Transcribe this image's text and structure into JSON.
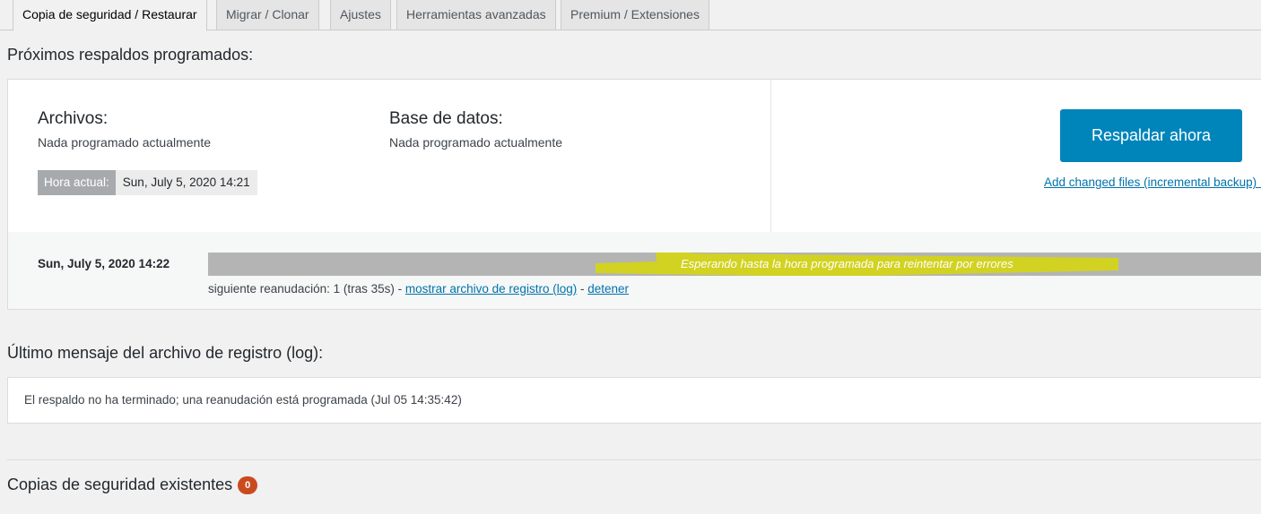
{
  "tabs": [
    {
      "label": "Copia de seguridad / Restaurar",
      "active": true
    },
    {
      "label": "Migrar / Clonar",
      "active": false
    },
    {
      "label": "Ajustes",
      "active": false
    },
    {
      "label": "Herramientas avanzadas",
      "active": false
    },
    {
      "label": "Premium / Extensiones",
      "active": false
    }
  ],
  "scheduled": {
    "heading": "Próximos respaldos programados:",
    "files_title": "Archivos:",
    "files_status": "Nada programado actualmente",
    "db_title": "Base de datos:",
    "db_status": "Nada programado actualmente",
    "current_time_label": "Hora actual:",
    "current_time_value": "Sun, July 5, 2020 14:21",
    "backup_now_label": "Respaldar ahora",
    "incremental_link": "Add changed files (incremental backup) ..."
  },
  "active_job": {
    "date": "Sun, July 5, 2020 14:22",
    "progress_text": "Esperando hasta la hora programada para reintentar por errores",
    "resume_prefix": "siguiente reanudación: 1 (tras 35s) -",
    "show_log_link": "mostrar archivo de registro (log)",
    "separator": "-",
    "stop_link": "detener",
    "highlight_color": "#d4d41a"
  },
  "log": {
    "heading": "Último mensaje del archivo de registro (log):",
    "message": "El respaldo no ha terminado; una reanudación está programada (Jul 05 14:35:42)"
  },
  "existing": {
    "heading": "Copias de seguridad existentes",
    "count": "0",
    "badge_color": "#ca4a1f"
  },
  "colors": {
    "primary_button": "#0085ba",
    "link": "#0073aa",
    "background": "#f1f1f1"
  }
}
